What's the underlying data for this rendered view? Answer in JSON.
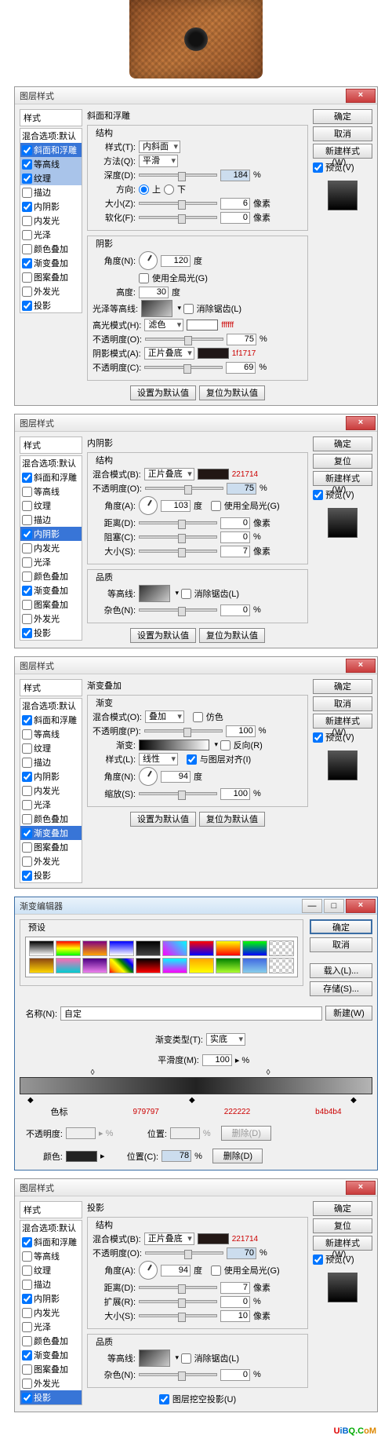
{
  "dialog_title": "图层样式",
  "styles_header": "样式",
  "blend_default": "混合选项:默认",
  "ok": "确定",
  "cancel": "取消",
  "reset": "复位",
  "new_style": "新建样式(W)...",
  "preview": "预览(V)",
  "set_default": "设置为默认值",
  "reset_default": "复位为默认值",
  "style_items": {
    "bevel": "斜面和浮雕",
    "contour": "等高线",
    "texture": "纹理",
    "stroke": "描边",
    "inner_shadow": "内阴影",
    "inner_glow": "内发光",
    "satin": "光泽",
    "color_overlay": "颜色叠加",
    "gradient_overlay": "渐变叠加",
    "pattern_overlay": "图案叠加",
    "outer_glow": "外发光",
    "drop_shadow": "投影"
  },
  "bevel": {
    "title": "斜面和浮雕",
    "structure": "结构",
    "style": "样式(T):",
    "style_v": "内斜面",
    "technique": "方法(Q):",
    "technique_v": "平滑",
    "depth": "深度(D):",
    "depth_v": "184",
    "pct": "%",
    "direction": "方向:",
    "up": "上",
    "down": "下",
    "size": "大小(Z):",
    "size_v": "6",
    "px": "像素",
    "soften": "软化(F):",
    "soften_v": "0",
    "shading": "阴影",
    "angle": "角度(N):",
    "angle_v": "120",
    "deg": "度",
    "use_global": "使用全局光(G)",
    "altitude": "高度:",
    "altitude_v": "30",
    "gloss_contour": "光泽等高线:",
    "anti_aliased": "消除锯齿(L)",
    "highlight_mode": "高光模式(H):",
    "highlight_mode_v": "滤色",
    "highlight_color": "ffffff",
    "highlight_opacity": "不透明度(O):",
    "highlight_opacity_v": "75",
    "shadow_mode": "阴影模式(A):",
    "shadow_mode_v": "正片叠底",
    "shadow_color": "1f1717",
    "shadow_opacity": "不透明度(C):",
    "shadow_opacity_v": "69"
  },
  "inner_shadow": {
    "title": "内阴影",
    "structure": "结构",
    "blend_mode": "混合模式(B):",
    "blend_mode_v": "正片叠底",
    "color": "221714",
    "opacity": "不透明度(O):",
    "opacity_v": "75",
    "angle": "角度(A):",
    "angle_v": "103",
    "use_global": "使用全局光(G)",
    "distance": "距离(D):",
    "distance_v": "0",
    "px": "像素",
    "choke": "阻塞(C):",
    "choke_v": "0",
    "pct": "%",
    "size": "大小(S):",
    "size_v": "7",
    "quality": "品质",
    "contour": "等高线:",
    "anti": "消除锯齿(L)",
    "noise": "杂色(N):",
    "noise_v": "0"
  },
  "grad_overlay": {
    "title": "渐变叠加",
    "gradient": "渐变",
    "blend_mode": "混合模式(O):",
    "blend_mode_v": "叠加",
    "dither": "仿色",
    "opacity": "不透明度(P):",
    "opacity_v": "100",
    "pct": "%",
    "gradient_lbl": "渐变:",
    "reverse": "反向(R)",
    "style": "样式(L):",
    "style_v": "线性",
    "align": "与图层对齐(I)",
    "angle": "角度(N):",
    "angle_v": "94",
    "deg": "度",
    "scale": "缩放(S):",
    "scale_v": "100"
  },
  "grad_editor": {
    "title": "渐变编辑器",
    "presets": "预设",
    "name_lbl": "名称(N):",
    "name_v": "自定",
    "new_btn": "新建(W)",
    "load": "载入(L)...",
    "save": "存储(S)...",
    "type": "渐变类型(T):",
    "type_v": "实底",
    "smoothness": "平滑度(M):",
    "smoothness_v": "100",
    "stops_lbl": "色标",
    "c1": "979797",
    "c2": "222222",
    "c3": "b4b4b4",
    "opacity": "不透明度:",
    "location": "位置:",
    "delete": "删除(D)",
    "color": "颜色:",
    "location2": "位置(C):",
    "location2_v": "78"
  },
  "drop_shadow": {
    "title": "投影",
    "structure": "结构",
    "blend_mode": "混合模式(B):",
    "blend_mode_v": "正片叠底",
    "color": "221714",
    "opacity": "不透明度(O):",
    "opacity_v": "70",
    "angle": "角度(A):",
    "angle_v": "94",
    "use_global": "使用全局光(G)",
    "distance": "距离(D):",
    "distance_v": "7",
    "px": "像素",
    "spread": "扩展(R):",
    "spread_v": "0",
    "pct": "%",
    "size": "大小(S):",
    "size_v": "10",
    "quality": "品质",
    "contour": "等高线:",
    "anti": "消除锯齿(L)",
    "noise": "杂色(N):",
    "noise_v": "0",
    "knockout": "图层挖空投影(U)"
  },
  "watermark": {
    "u": "U",
    "i": "iB",
    "q": "Q.C",
    "om": "oM"
  }
}
